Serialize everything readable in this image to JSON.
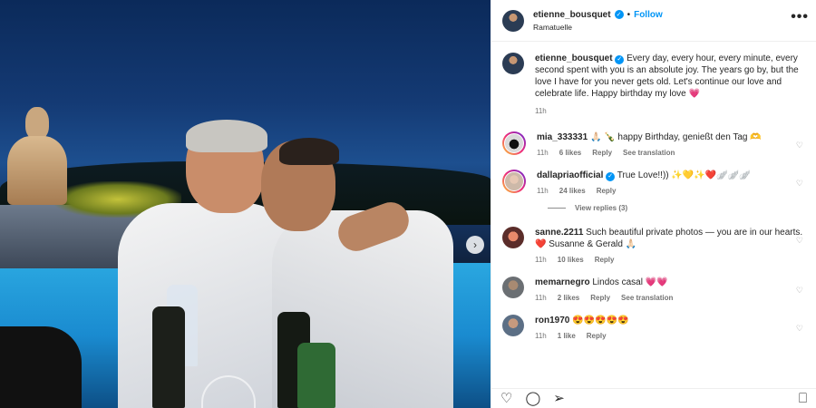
{
  "post": {
    "username": "etienne_bousquet",
    "separator": "•",
    "follow_label": "Follow",
    "location": "Ramatuelle",
    "more_icon": "more-horizontal-icon",
    "caption": "Every day, every hour, every minute, every second spent with you is an absolute joy. The years go by, but the love I have for you never gets old. Let's continue our love and celebrate life. Happy birthday my love 💗",
    "caption_time": "11h"
  },
  "comments": [
    {
      "username": "mia_333331",
      "text": "🙏🏻 🍾 happy Birthday, genießt den Tag 🫶",
      "time": "11h",
      "likes": "6 likes",
      "reply": "Reply",
      "translation": "See translation"
    },
    {
      "username": "dallapriaofficial",
      "text": "True Love!!)) ✨💛✨❤️🪽🪽🪽",
      "time": "11h",
      "likes": "24 likes",
      "reply": "Reply",
      "view_replies": "View replies (3)"
    },
    {
      "username": "sanne.2211",
      "text": "Such beautiful private photos — you are in our hearts.❤️ Susanne & Gerald 🙏🏻",
      "time": "11h",
      "likes": "10 likes",
      "reply": "Reply"
    },
    {
      "username": "memarnegro",
      "text": "Lindos casal 💗💗",
      "time": "11h",
      "likes": "2 likes",
      "reply": "Reply",
      "translation": "See translation"
    },
    {
      "username": "ron1970",
      "text": "😍😍😍😍😍",
      "time": "11h",
      "likes": "1 like",
      "reply": "Reply"
    }
  ],
  "icons": {
    "verified": "✓",
    "heart": "♡",
    "next": "›",
    "like": "♡",
    "comment": "◯",
    "share": "➢",
    "save": "⎕",
    "more": "•••"
  },
  "colors": {
    "link_blue": "#0095f6",
    "muted": "#737373",
    "text": "#262626"
  }
}
